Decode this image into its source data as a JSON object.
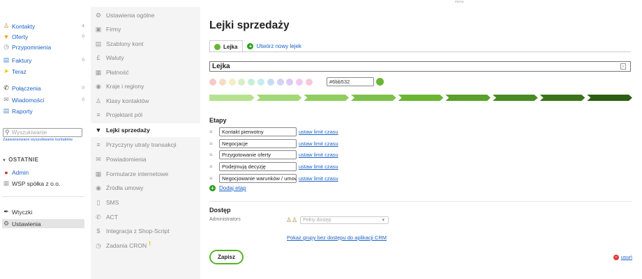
{
  "top_menu_label": "menu",
  "sidebar": {
    "items": [
      {
        "label": "Kontakty",
        "count": "4",
        "icon": "user-icon"
      },
      {
        "label": "Oferty",
        "count": "0",
        "icon": "funnel-icon"
      },
      {
        "label": "Przypomnienia",
        "count": "",
        "icon": "clock-icon"
      },
      {
        "label": "Faktury",
        "count": "0",
        "icon": "invoice-icon"
      },
      {
        "label": "Teraz",
        "count": "",
        "icon": "lightning-icon"
      },
      {
        "label": "Połączenia",
        "count": "0",
        "icon": "phone-icon"
      },
      {
        "label": "Wiadomości",
        "count": "0",
        "icon": "mail-icon"
      },
      {
        "label": "Raporty",
        "count": "",
        "icon": "chart-icon"
      }
    ],
    "search_placeholder": "Wyszukiwanie",
    "advanced_search": "Zaawansowane wyszukiwanie kontaktów",
    "recent_header": "OSTATNIE",
    "recent_items": [
      {
        "label": "Admin",
        "icon": "avatar-icon"
      },
      {
        "label": "WSP spółka z o.o.",
        "icon": "company-icon"
      }
    ],
    "bottom_items": [
      {
        "label": "Wtyczki",
        "icon": "plug-icon"
      },
      {
        "label": "Ustawienia",
        "icon": "gear-icon"
      }
    ]
  },
  "settings_menu": [
    {
      "label": "Ustawienia ogólne",
      "icon": "gear-icon"
    },
    {
      "label": "Firmy",
      "icon": "briefcase-icon"
    },
    {
      "label": "Szablony kont",
      "icon": "document-icon"
    },
    {
      "label": "Waluty",
      "icon": "pound-icon"
    },
    {
      "label": "Płatność",
      "icon": "payment-icon"
    },
    {
      "label": "Kraje i regiony",
      "icon": "globe-icon"
    },
    {
      "label": "Klasy kontaktów",
      "icon": "users-icon"
    },
    {
      "label": "Projektant pól",
      "icon": "list-icon"
    },
    {
      "label": "Lejki sprzedaży",
      "icon": "funnel-icon"
    },
    {
      "label": "Przyczyny utraty transakcji",
      "icon": "bullets-icon"
    },
    {
      "label": "Powiadomienia",
      "icon": "envelope-icon"
    },
    {
      "label": "Formularze internetowe",
      "icon": "form-icon"
    },
    {
      "label": "Źródła umowy",
      "icon": "source-icon"
    },
    {
      "label": "SMS",
      "icon": "mobile-icon"
    },
    {
      "label": "ACT",
      "icon": "phone-icon"
    },
    {
      "label": "Integracja z Shop-Script",
      "icon": "dollar-icon"
    },
    {
      "label": "Zadania CRON",
      "icon": "clock-icon",
      "warning": "!"
    }
  ],
  "main": {
    "title": "Lejki sprzedaży",
    "tab_active": "Lejka",
    "tab_new": "Utwórz nowy lejek",
    "funnel_name": "Lejka",
    "color_hex": "#6bb532",
    "swatch_colors": [
      "#f7c9c9",
      "#f7dcc4",
      "#f3eec3",
      "#d6efc7",
      "#c7efd8",
      "#c7ebef",
      "#c7dcf2",
      "#cfd4f5",
      "#dccbf5",
      "#efc9ef",
      "#f5c9dc"
    ],
    "funnel_colors": [
      "#b6e290",
      "#a3d877",
      "#8fcd5f",
      "#7cc14b",
      "#6bb532",
      "#5aa02a",
      "#4a8a22",
      "#3b741a",
      "#2d5f13"
    ],
    "stages_title": "Etapy",
    "stages": [
      "Kontakt pierwotny",
      "Negocjacje",
      "Przygotowanie oferty",
      "Podejmują decyzję",
      "Negocjowanie warunków / umowy"
    ],
    "time_limit_link": "ustaw limit czasu",
    "add_stage": "Dodaj etap",
    "access_title": "Dostęp",
    "access_group": "Administrators",
    "access_value": "Pełny dostęp",
    "show_groups_link": "Pokaż grupy bez dostępu do aplikacji CRM",
    "save_button": "Zapisz",
    "delete_link": "usuń"
  }
}
